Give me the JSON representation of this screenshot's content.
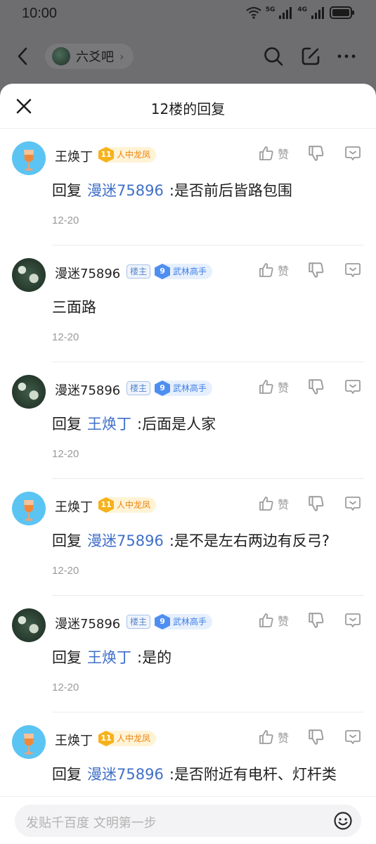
{
  "status_bar": {
    "time": "10:00",
    "net1": "5G",
    "net2": "4G"
  },
  "nav": {
    "forum_name": "六爻吧",
    "chevron": "›"
  },
  "sheet": {
    "title": "12楼的回复"
  },
  "labels": {
    "reply_prefix": "回复",
    "colon": ":",
    "like": "赞"
  },
  "replies": [
    {
      "user": "王焕丁",
      "avatar": "wine",
      "host": false,
      "level": "11",
      "level_title": "人中龙凤",
      "level_color": "gold",
      "reply_to": "漫迷75896",
      "text": ":是否前后皆路包围",
      "date": "12-20"
    },
    {
      "user": "漫迷75896",
      "avatar": "moss",
      "host": true,
      "host_label": "楼主",
      "level": "9",
      "level_title": "武林高手",
      "level_color": "blue",
      "reply_to": "",
      "text": "三面路",
      "date": "12-20"
    },
    {
      "user": "漫迷75896",
      "avatar": "moss",
      "host": true,
      "host_label": "楼主",
      "level": "9",
      "level_title": "武林高手",
      "level_color": "blue",
      "reply_to": "王焕丁",
      "text": ":后面是人家",
      "date": "12-20"
    },
    {
      "user": "王焕丁",
      "avatar": "wine",
      "host": false,
      "level": "11",
      "level_title": "人中龙凤",
      "level_color": "gold",
      "reply_to": "漫迷75896",
      "text": ":是不是左右两边有反弓?",
      "date": "12-20"
    },
    {
      "user": "漫迷75896",
      "avatar": "moss",
      "host": true,
      "host_label": "楼主",
      "level": "9",
      "level_title": "武林高手",
      "level_color": "blue",
      "reply_to": "王焕丁",
      "text": ":是的",
      "date": "12-20"
    },
    {
      "user": "王焕丁",
      "avatar": "wine",
      "host": false,
      "level": "11",
      "level_title": "人中龙凤",
      "level_color": "gold",
      "reply_to": "漫迷75896",
      "text": ":是否附近有电杆、灯杆类",
      "date": ""
    }
  ],
  "composer": {
    "placeholder": "发贴千百度 文明第一步"
  },
  "colors": {
    "link_blue": "#3f6fc9",
    "overlay": "#6e6e70"
  }
}
